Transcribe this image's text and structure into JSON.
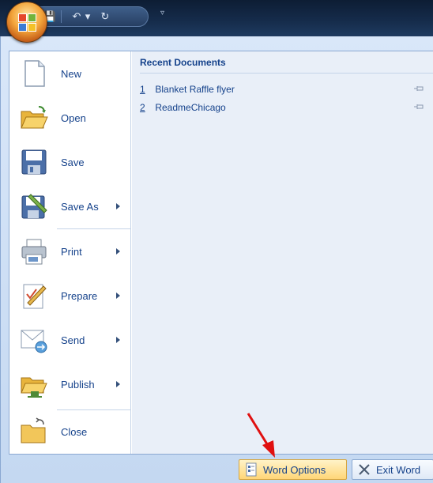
{
  "title_bar": {
    "quick_access": [
      {
        "icon": "save-icon",
        "glyph": "💾"
      },
      {
        "icon": "undo-icon",
        "glyph": "↶"
      },
      {
        "icon": "dropdown-icon",
        "glyph": "▾"
      },
      {
        "icon": "redo-icon",
        "glyph": "↻"
      }
    ],
    "customize_glyph": "▿"
  },
  "office_button": {
    "icon": "office-logo-icon"
  },
  "menu": {
    "items": [
      {
        "name": "new",
        "label": "New",
        "has_submenu": false,
        "icon": "new-document-icon"
      },
      {
        "name": "open",
        "label": "Open",
        "has_submenu": false,
        "icon": "open-folder-icon"
      },
      {
        "name": "save",
        "label": "Save",
        "has_submenu": false,
        "icon": "save-disk-icon"
      },
      {
        "name": "save-as",
        "label": "Save As",
        "has_submenu": true,
        "icon": "save-as-icon"
      },
      {
        "name": "print",
        "label": "Print",
        "has_submenu": true,
        "icon": "printer-icon"
      },
      {
        "name": "prepare",
        "label": "Prepare",
        "has_submenu": true,
        "icon": "prepare-icon"
      },
      {
        "name": "send",
        "label": "Send",
        "has_submenu": true,
        "icon": "send-icon"
      },
      {
        "name": "publish",
        "label": "Publish",
        "has_submenu": true,
        "icon": "publish-icon"
      },
      {
        "name": "close",
        "label": "Close",
        "has_submenu": false,
        "icon": "close-folder-icon"
      }
    ]
  },
  "recent": {
    "title": "Recent Documents",
    "items": [
      {
        "num": "1",
        "name": "Blanket Raffle flyer"
      },
      {
        "num": "2",
        "name": "ReadmeChicago"
      }
    ]
  },
  "buttons": {
    "word_options": "Word Options",
    "exit_word": "Exit Word"
  },
  "colors": {
    "accent": "#15428b",
    "highlight_button": "#ffd677",
    "annotation_arrow": "#e01010"
  }
}
